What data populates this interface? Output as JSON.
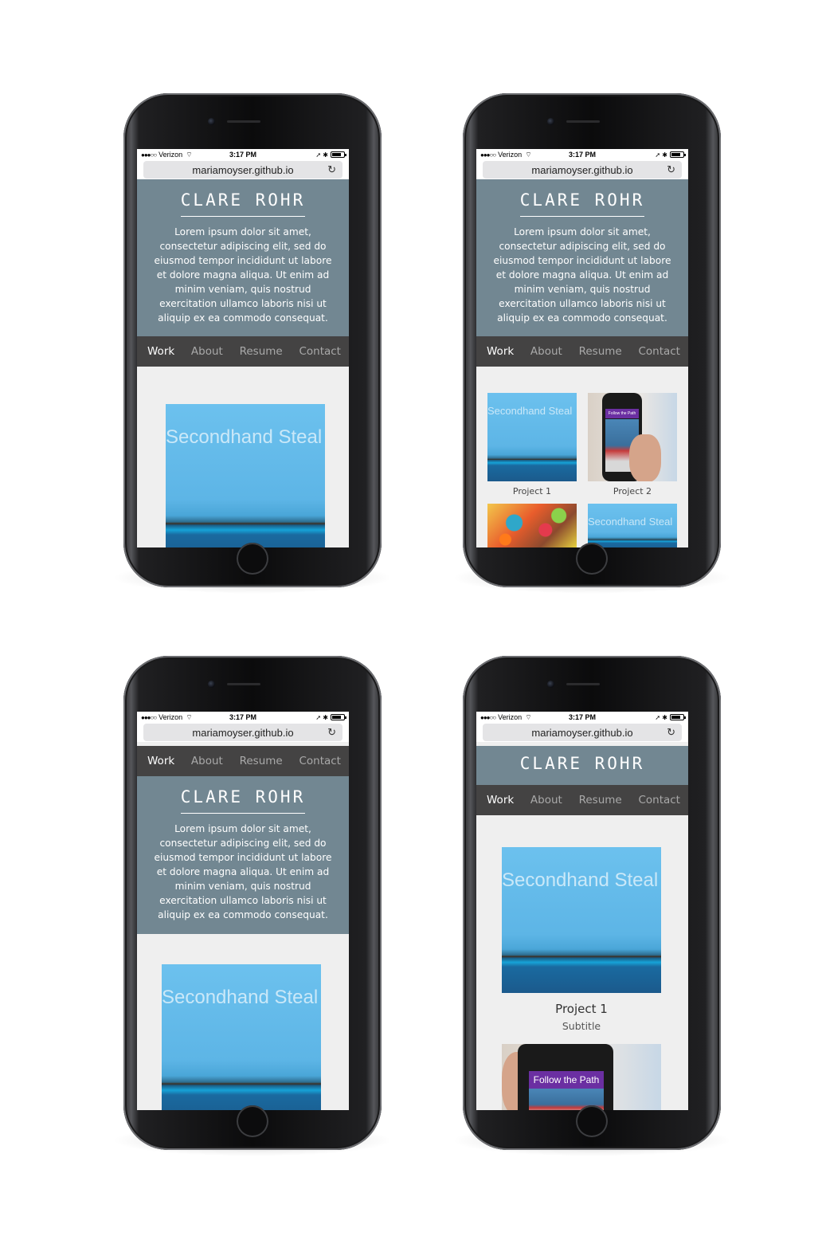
{
  "status": {
    "signal_dots": "●●●○○",
    "carrier": "Verizon",
    "wifi": "⌔",
    "time": "3:17 PM",
    "right_icons": "➚ ✱"
  },
  "browser": {
    "url": "mariamoyser.github.io",
    "reload_icon": "↻"
  },
  "site": {
    "title": "CLARE ROHR",
    "bio": "Lorem ipsum dolor sit amet, consectetur adipiscing elit, sed do eiusmod tempor incididunt ut labore et dolore magna aliqua. Ut enim ad minim veniam, quis nostrud exercitation ullamco laboris nisi ut aliquip ex ea commodo consequat.",
    "nav": [
      "Work",
      "About",
      "Resume",
      "Contact"
    ]
  },
  "projects": [
    {
      "title": "Project 1",
      "subtitle": "Subtitle",
      "image_text": "Secondhand Steal"
    },
    {
      "title": "Project 2",
      "image_text": "Follow the Path"
    }
  ]
}
